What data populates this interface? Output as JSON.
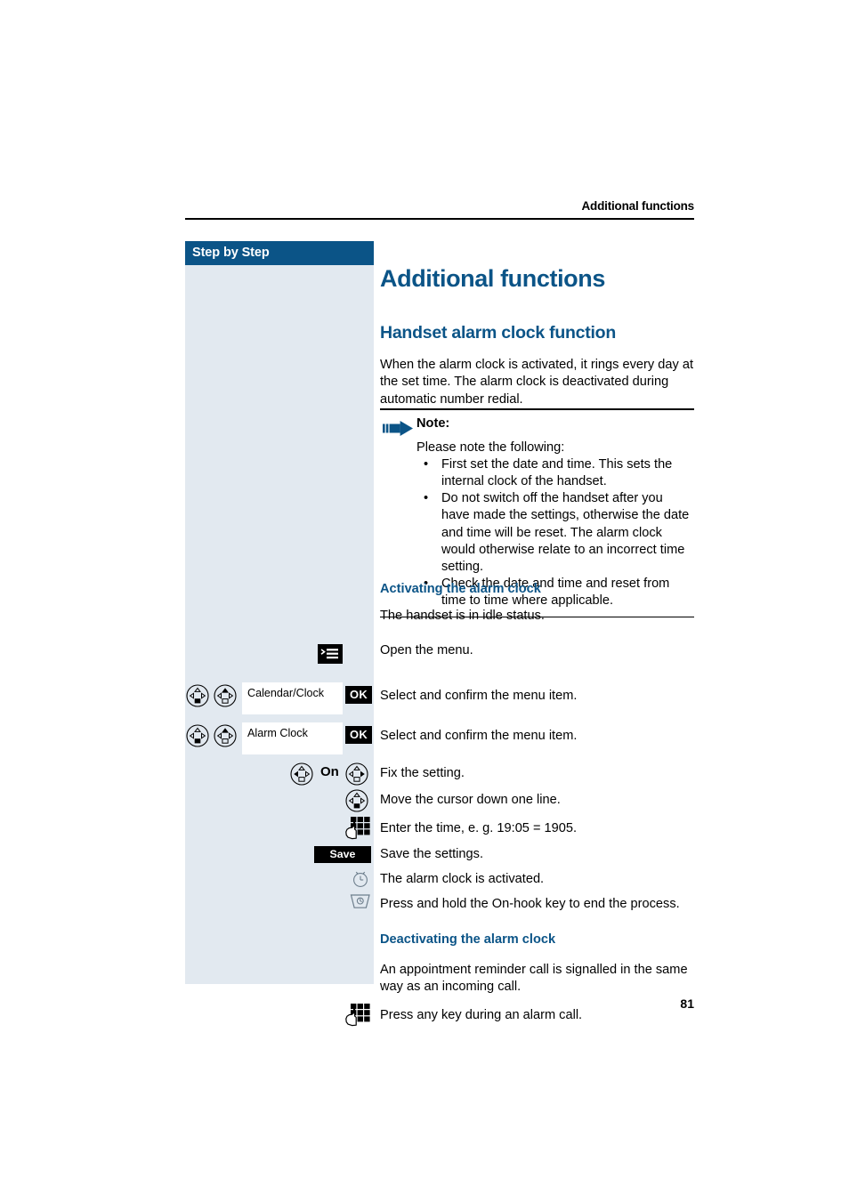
{
  "header": {
    "running_title": "Additional functions"
  },
  "sidebar": {
    "title": "Step by Step"
  },
  "content": {
    "doc_title": "Additional functions",
    "section_title": "Handset alarm clock function",
    "intro": "When the alarm clock is activated, it rings every day at the set time. The alarm clock is deactivated during automatic number redial."
  },
  "note": {
    "heading": "Note:",
    "lead": "Please note the following:",
    "bullet_char": "•",
    "items": [
      "First set the date and time. This sets the internal clock of the handset.",
      "Do not switch off the handset after you have made the settings, otherwise the date and time will be reset. The alarm clock would otherwise relate to an incorrect time setting.",
      "Check the date and time and reset from time to time where applicable."
    ]
  },
  "activating": {
    "sub_title": "Activating the alarm clock",
    "intro": "The handset is in idle status.",
    "steps": [
      {
        "icons": [
          "menu-key-icon"
        ],
        "text": "Open the menu."
      },
      {
        "icons": [
          "nav-key-down-icon",
          "nav-key-up-icon"
        ],
        "menu_label": "Calendar/Clock",
        "ok_label": "OK",
        "text": "Select and confirm the menu item."
      },
      {
        "icons": [
          "nav-key-down-icon",
          "nav-key-up-icon"
        ],
        "menu_label": "Alarm Clock",
        "ok_label": "OK",
        "text": "Select and confirm the menu item."
      },
      {
        "icons": [
          "nav-key-left-icon",
          "nav-key-right-icon"
        ],
        "inline_label": "On",
        "text": "Fix the setting."
      },
      {
        "icons": [
          "nav-key-down-icon"
        ],
        "text": "Move the cursor down one line."
      },
      {
        "icons": [
          "keypad-icon"
        ],
        "text": "Enter the time, e. g. 19:05 = 1905."
      },
      {
        "icons": [
          "save-softkey"
        ],
        "save_label": "Save",
        "text": "Save the settings."
      },
      {
        "icons": [
          "clock-icon"
        ],
        "text": "The alarm clock is activated."
      },
      {
        "icons": [
          "on-hook-key-icon"
        ],
        "text": "Press and hold the On-hook key to end the process."
      }
    ]
  },
  "deactivating": {
    "sub_title": "Deactivating the alarm clock",
    "intro": "An appointment reminder call is signalled in the same way as an incoming call.",
    "steps": [
      {
        "icons": [
          "keypad-icon"
        ],
        "text": "Press any key during an alarm call."
      }
    ]
  },
  "footer": {
    "page_number": "81"
  },
  "colors": {
    "brand_blue": "#0b5487",
    "sidebar_bg": "#e2e9f0",
    "key_black": "#000000"
  }
}
